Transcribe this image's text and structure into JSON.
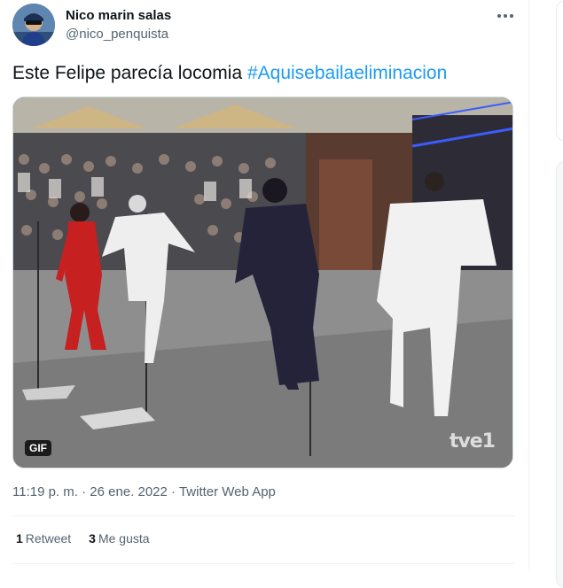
{
  "author": {
    "name": "Nico marin salas",
    "handle": "@nico_penquista"
  },
  "tweet": {
    "text": "Este Felipe parecía locomia ",
    "hashtag": "#Aquisebailaeliminacion"
  },
  "media": {
    "badge": "GIF",
    "watermark": "tve1"
  },
  "meta": {
    "time": "11:19 p. m.",
    "separator": " · ",
    "date": "26 ene. 2022",
    "app": "Twitter Web App"
  },
  "stats": {
    "retweets_count": "1",
    "retweets_label": "Retweet",
    "likes_count": "3",
    "likes_label": "Me gusta"
  },
  "colors": {
    "accent": "#1d9bf0",
    "secondary_text": "#536471"
  }
}
